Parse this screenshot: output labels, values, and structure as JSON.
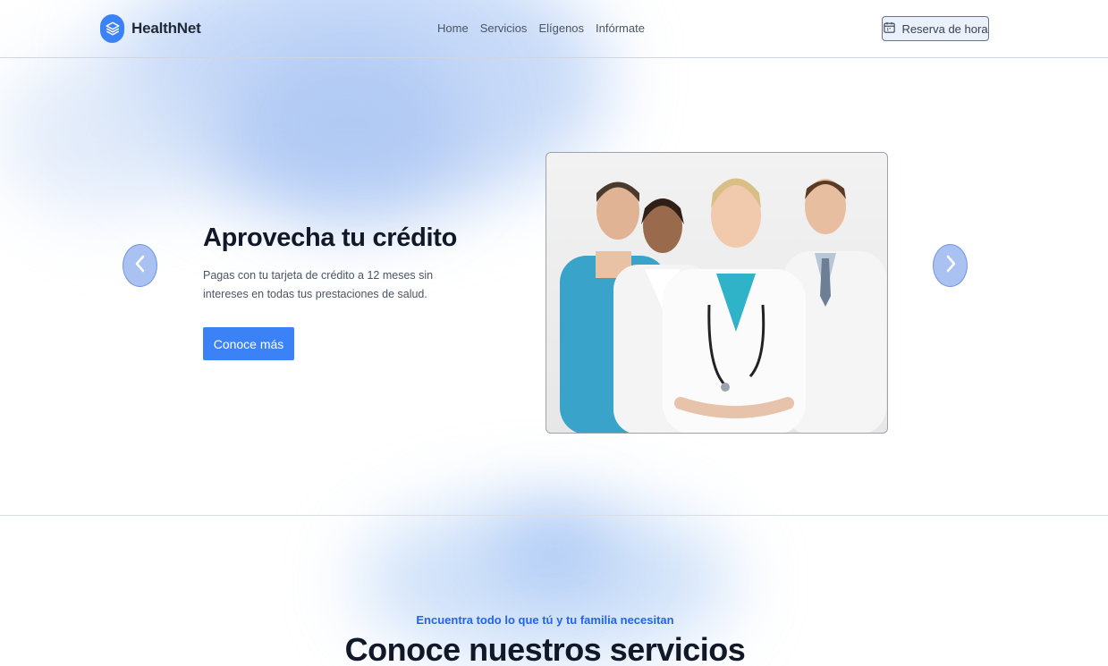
{
  "header": {
    "brand": "HealthNet",
    "logo_icon": "layers-icon",
    "nav": [
      "Home",
      "Servicios",
      "Elígenos",
      "Infórmate"
    ],
    "reserve_label": "Reserva de hora",
    "reserve_icon": "calendar-icon"
  },
  "hero": {
    "title": "Aprovecha tu crédito",
    "text": "Pagas con tu tarjeta de crédito a 12 meses sin intereses en todas tus prestaciones de salud.",
    "button_label": "Conoce más",
    "prev_icon": "chevron-left-icon",
    "next_icon": "chevron-right-icon"
  },
  "services": {
    "subtitle": "Encuentra todo lo que tú y tu familia necesitan",
    "title": "Conoce nuestros servicios"
  },
  "colors": {
    "accent": "#3b82f6",
    "accent_text": "#2563eb"
  }
}
